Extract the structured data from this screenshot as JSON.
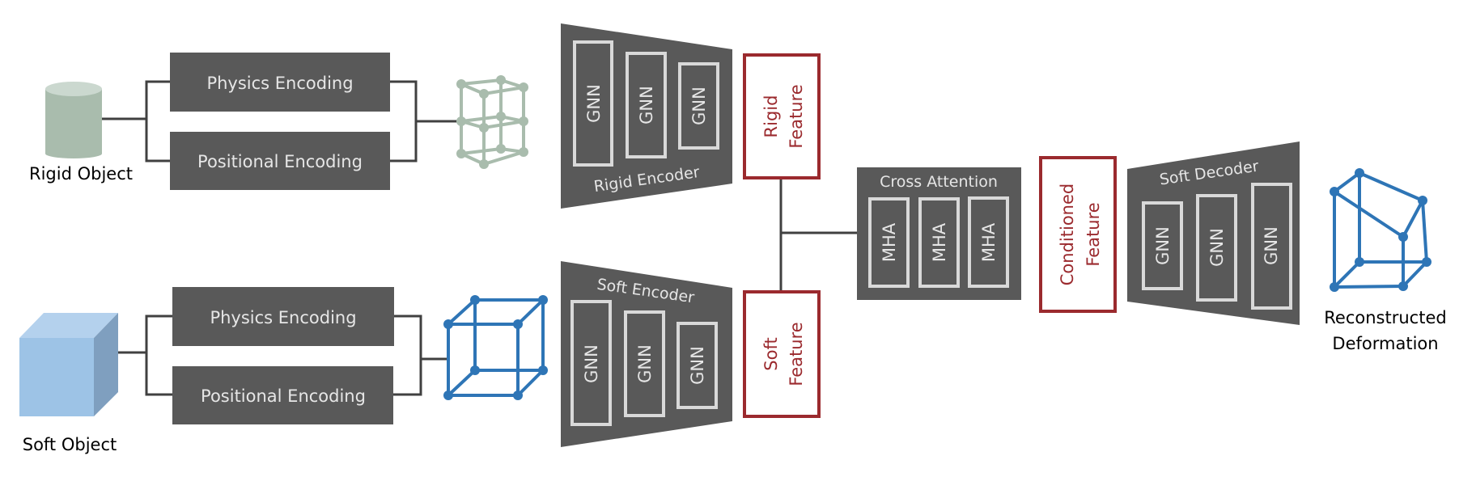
{
  "rigid_branch": {
    "object_label": "Rigid Object",
    "physics_encoding": "Physics Encoding",
    "positional_encoding": "Positional Encoding",
    "encoder_label": "Rigid Encoder",
    "layers": [
      "GNN",
      "GNN",
      "GNN"
    ],
    "feature_line1": "Rigid",
    "feature_line2": "Feature"
  },
  "soft_branch": {
    "object_label": "Soft Object",
    "physics_encoding": "Physics Encoding",
    "positional_encoding": "Positional Encoding",
    "encoder_label": "Soft Encoder",
    "layers": [
      "GNN",
      "GNN",
      "GNN"
    ],
    "feature_line1": "Soft",
    "feature_line2": "Feature"
  },
  "cross_attention": {
    "title": "Cross Attention",
    "heads": [
      "MHA",
      "MHA",
      "MHA"
    ]
  },
  "conditioned_feature": {
    "line1": "Conditioned",
    "line2": "Feature"
  },
  "decoder": {
    "title": "Soft Decoder",
    "layers": [
      "GNN",
      "GNN",
      "GNN"
    ]
  },
  "output": {
    "line1": "Reconstructed",
    "line2": "Deformation"
  },
  "colors": {
    "block": "#595959",
    "inner_border": "#d9d9d9",
    "block_text": "#e6e6e6",
    "feature_red": "#9b2a2e",
    "rigid_green": "#a9bcad",
    "soft_blue": "#2e75b6",
    "cube_face": "#9dc3e6",
    "line": "#404040"
  }
}
